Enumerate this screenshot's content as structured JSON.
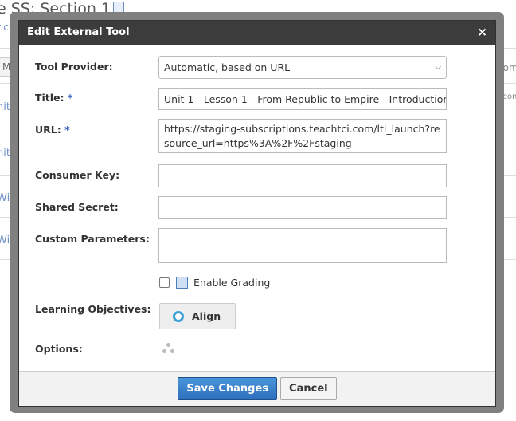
{
  "background": {
    "title": "e SS: Section 1",
    "crumb": "ricul",
    "tab": "Mat",
    "links": [
      "nit",
      "nit",
      "With",
      "With"
    ],
    "right_texts": [
      "com",
      "pcon"
    ]
  },
  "dialog": {
    "title": "Edit External Tool",
    "close": "×",
    "labels": {
      "provider": "Tool Provider:",
      "title": "Title:",
      "url": "URL:",
      "required": "*",
      "consumer_key": "Consumer Key:",
      "shared_secret": "Shared Secret:",
      "custom_params": "Custom Parameters:",
      "objectives": "Learning Objectives:",
      "options": "Options:"
    },
    "provider_value": "Automatic, based on URL",
    "title_value": "Unit 1 - Lesson 1 - From Republic to Empire - Introduction",
    "url_value": "https://staging-subscriptions.teachtci.com/lti_launch?resource_url=https%3A%2F%2Fstaging-",
    "consumer_key": "",
    "shared_secret": "",
    "custom_params": "",
    "enable_grading": {
      "label": "Enable Grading",
      "checked": false
    },
    "align_label": "Align",
    "save_label": "Save Changes",
    "cancel_label": "Cancel"
  }
}
